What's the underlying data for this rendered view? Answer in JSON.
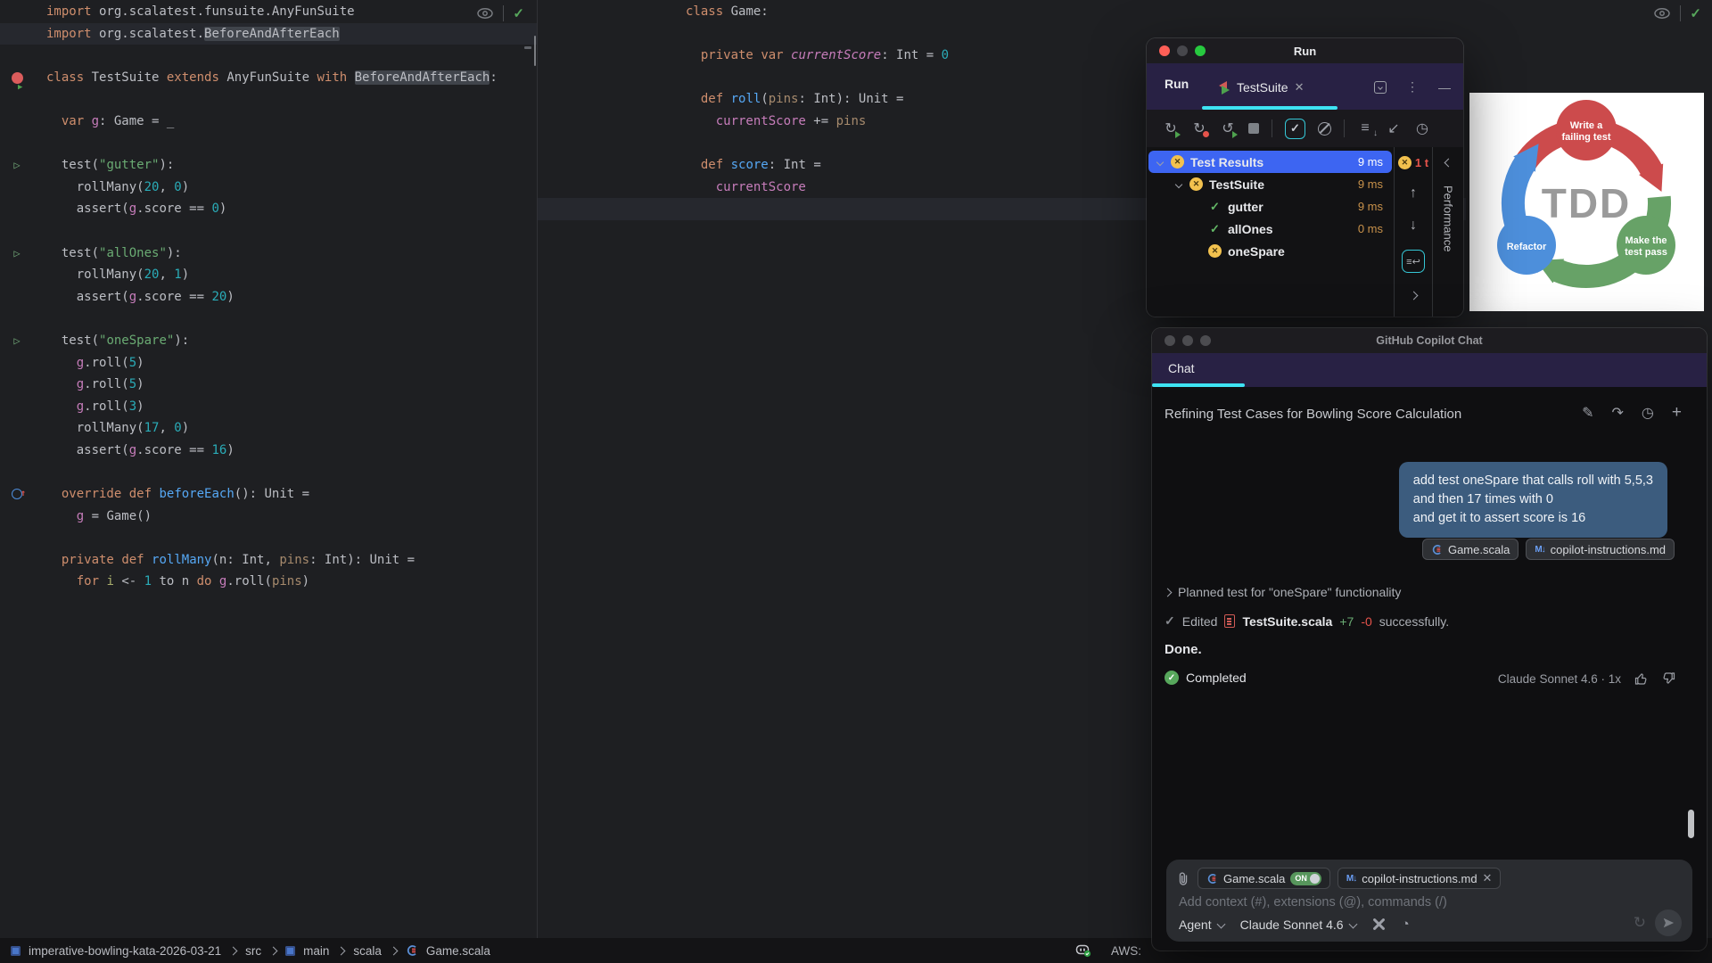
{
  "colors": {
    "accent_cyan": "#3EE3F3",
    "selection_blue": "#3D65F2",
    "fail_yellow": "#F2C14E",
    "pass_green": "#57A75C",
    "error_red": "#E5534B",
    "time_orange": "#C9924B",
    "bubble_blue": "#3C5C7E",
    "tdd_red": "#CC4B4C",
    "tdd_green": "#67A267",
    "tdd_blue": "#4D8FDB"
  },
  "editors": {
    "left": {
      "lines": [
        {
          "t": [
            [
              "kw",
              "import"
            ],
            [
              "d",
              " org.scalatest.funsuite.AnyFunSuite"
            ]
          ]
        },
        {
          "hl": true,
          "t": [
            [
              "kw",
              "import"
            ],
            [
              "d",
              " org.scalatest."
            ],
            [
              "box",
              "BeforeAndAfterEach"
            ]
          ]
        },
        {
          "t": []
        },
        {
          "g": "cls",
          "t": [
            [
              "kw",
              "class"
            ],
            [
              "d",
              " TestSuite "
            ],
            [
              "kw",
              "extends"
            ],
            [
              "d",
              " AnyFunSuite "
            ],
            [
              "kw",
              "with"
            ],
            [
              "d",
              " "
            ],
            [
              "box",
              "BeforeAndAfterEach"
            ],
            [
              "d",
              ":"
            ]
          ]
        },
        {
          "t": []
        },
        {
          "t": [
            [
              "d",
              "  "
            ],
            [
              "kw",
              "var"
            ],
            [
              "fld",
              " g"
            ],
            [
              "d",
              ": Game = _"
            ]
          ]
        },
        {
          "t": []
        },
        {
          "g": "play",
          "t": [
            [
              "d",
              "  test("
            ],
            [
              "str",
              "\"gutter\""
            ],
            [
              "d",
              "):"
            ]
          ]
        },
        {
          "t": [
            [
              "d",
              "    rollMany("
            ],
            [
              "num",
              "20"
            ],
            [
              "d",
              ", "
            ],
            [
              "num",
              "0"
            ],
            [
              "d",
              ")"
            ]
          ]
        },
        {
          "t": [
            [
              "d",
              "    assert("
            ],
            [
              "fld",
              "g"
            ],
            [
              "d",
              ".score == "
            ],
            [
              "num",
              "0"
            ],
            [
              "d",
              ")"
            ]
          ]
        },
        {
          "t": []
        },
        {
          "g": "play",
          "t": [
            [
              "d",
              "  test("
            ],
            [
              "str",
              "\"allOnes\""
            ],
            [
              "d",
              "):"
            ]
          ]
        },
        {
          "t": [
            [
              "d",
              "    rollMany("
            ],
            [
              "num",
              "20"
            ],
            [
              "d",
              ", "
            ],
            [
              "num",
              "1"
            ],
            [
              "d",
              ")"
            ]
          ]
        },
        {
          "t": [
            [
              "d",
              "    assert("
            ],
            [
              "fld",
              "g"
            ],
            [
              "d",
              ".score == "
            ],
            [
              "num",
              "20"
            ],
            [
              "d",
              ")"
            ]
          ]
        },
        {
          "t": []
        },
        {
          "g": "play",
          "t": [
            [
              "d",
              "  test("
            ],
            [
              "str",
              "\"oneSpare\""
            ],
            [
              "d",
              "):"
            ]
          ]
        },
        {
          "t": [
            [
              "d",
              "    "
            ],
            [
              "fld",
              "g"
            ],
            [
              "d",
              ".roll("
            ],
            [
              "num",
              "5"
            ],
            [
              "d",
              ")"
            ]
          ]
        },
        {
          "t": [
            [
              "d",
              "    "
            ],
            [
              "fld",
              "g"
            ],
            [
              "d",
              ".roll("
            ],
            [
              "num",
              "5"
            ],
            [
              "d",
              ")"
            ]
          ]
        },
        {
          "t": [
            [
              "d",
              "    "
            ],
            [
              "fld",
              "g"
            ],
            [
              "d",
              ".roll("
            ],
            [
              "num",
              "3"
            ],
            [
              "d",
              ")"
            ]
          ]
        },
        {
          "t": [
            [
              "d",
              "    rollMany("
            ],
            [
              "num",
              "17"
            ],
            [
              "d",
              ", "
            ],
            [
              "num",
              "0"
            ],
            [
              "d",
              ")"
            ]
          ]
        },
        {
          "t": [
            [
              "d",
              "    assert("
            ],
            [
              "fld",
              "g"
            ],
            [
              "d",
              ".score == "
            ],
            [
              "num",
              "16"
            ],
            [
              "d",
              ")"
            ]
          ]
        },
        {
          "t": []
        },
        {
          "g": "ovr",
          "t": [
            [
              "d",
              "  "
            ],
            [
              "kw",
              "override"
            ],
            [
              "d",
              " "
            ],
            [
              "kw",
              "def"
            ],
            [
              "d",
              " "
            ],
            [
              "fn",
              "beforeEach"
            ],
            [
              "d",
              "(): Unit ="
            ]
          ]
        },
        {
          "t": [
            [
              "d",
              "    "
            ],
            [
              "fld",
              "g"
            ],
            [
              "d",
              " = Game()"
            ]
          ]
        },
        {
          "t": []
        },
        {
          "t": [
            [
              "d",
              "  "
            ],
            [
              "kw",
              "private"
            ],
            [
              "d",
              " "
            ],
            [
              "kw",
              "def"
            ],
            [
              "d",
              " "
            ],
            [
              "fn",
              "rollMany"
            ],
            [
              "d",
              "(n: Int, "
            ],
            [
              "par",
              "pins"
            ],
            [
              "d",
              ": Int): Unit ="
            ]
          ]
        },
        {
          "t": [
            [
              "d",
              "    "
            ],
            [
              "kw",
              "for"
            ],
            [
              "d",
              " "
            ],
            [
              "loc",
              "i"
            ],
            [
              "d",
              " <- "
            ],
            [
              "num",
              "1"
            ],
            [
              "d",
              " to n "
            ],
            [
              "kw",
              "do"
            ],
            [
              "d",
              " "
            ],
            [
              "fld",
              "g"
            ],
            [
              "d",
              ".roll("
            ],
            [
              "par",
              "pins"
            ],
            [
              "d",
              ")"
            ]
          ]
        }
      ]
    },
    "middle": {
      "lines": [
        {
          "t": [
            [
              "kw",
              "class"
            ],
            [
              "d",
              " Game:"
            ]
          ]
        },
        {
          "t": []
        },
        {
          "t": [
            [
              "d",
              "  "
            ],
            [
              "kw",
              "private"
            ],
            [
              "d",
              " "
            ],
            [
              "kw",
              "var"
            ],
            [
              "d",
              " "
            ],
            [
              "fldi",
              "currentScore"
            ],
            [
              "d",
              ": Int = "
            ],
            [
              "num",
              "0"
            ]
          ]
        },
        {
          "t": []
        },
        {
          "t": [
            [
              "d",
              "  "
            ],
            [
              "kw",
              "def"
            ],
            [
              "d",
              " "
            ],
            [
              "fn",
              "roll"
            ],
            [
              "d",
              "("
            ],
            [
              "par",
              "pins"
            ],
            [
              "d",
              ": Int): Unit ="
            ]
          ]
        },
        {
          "t": [
            [
              "d",
              "    "
            ],
            [
              "fld",
              "currentScore"
            ],
            [
              "d",
              " += "
            ],
            [
              "par",
              "pins"
            ]
          ]
        },
        {
          "t": []
        },
        {
          "t": [
            [
              "d",
              "  "
            ],
            [
              "kw",
              "def"
            ],
            [
              "d",
              " "
            ],
            [
              "fn",
              "score"
            ],
            [
              "d",
              ": Int ="
            ]
          ]
        },
        {
          "t": [
            [
              "d",
              "    "
            ],
            [
              "fld",
              "currentScore"
            ]
          ]
        },
        {
          "hl": true,
          "t": []
        }
      ]
    }
  },
  "run_panel": {
    "window_title": "Run",
    "toolwindow_label": "Run",
    "tab_label": "TestSuite",
    "tree": [
      {
        "level": 0,
        "chevron": true,
        "icon": "fail",
        "label": "Test Results",
        "time": "9 ms",
        "selected": true
      },
      {
        "level": 1,
        "chevron": true,
        "icon": "fail",
        "label": "TestSuite",
        "time": "9 ms"
      },
      {
        "level": 2,
        "chevron": false,
        "icon": "pass",
        "label": "gutter",
        "time": "9 ms"
      },
      {
        "level": 2,
        "chevron": false,
        "icon": "pass",
        "label": "allOnes",
        "time": "0 ms"
      },
      {
        "level": 2,
        "chevron": false,
        "icon": "fail",
        "label": "oneSpare",
        "time": ""
      }
    ],
    "fail_badge_label": "1 t",
    "side_tab_label": "Performance"
  },
  "tdd": {
    "center": "TDD",
    "red_line1": "Write a",
    "red_line2": "failing test",
    "green_line1": "Make the",
    "green_line2": "test pass",
    "blue_line1": "Refactor"
  },
  "copilot": {
    "window_title": "GitHub Copilot Chat",
    "tab_label": "Chat",
    "thread_title": "Refining Test Cases for Bowling Score Calculation",
    "user_message": [
      "add test oneSpare that calls roll with 5,5,3",
      "and then 17 times with 0",
      "and get it to assert score is 16"
    ],
    "message_chips": [
      "Game.scala",
      "copilot-instructions.md"
    ],
    "planned": "Planned test for \"oneSpare\" functionality",
    "edited": {
      "check_prefix": "Edited",
      "file": "TestSuite.scala",
      "added": "+7",
      "removed": "-0",
      "suffix": "successfully."
    },
    "done": "Done.",
    "completed": "Completed",
    "model_usage": "Claude Sonnet 4.6 · 1x",
    "input": {
      "chip_game": {
        "label": "Game.scala",
        "toggle": "ON"
      },
      "chip_md": {
        "label": "copilot-instructions.md"
      },
      "placeholder": "Add context (#), extensions (@), commands (/)",
      "mode": "Agent",
      "model": "Claude Sonnet 4.6"
    }
  },
  "status_bar": {
    "breadcrumbs": [
      "imperative-bowling-kata-2026-03-21",
      "src",
      "main",
      "scala",
      "Game.scala"
    ],
    "aws_label": "AWS:"
  }
}
